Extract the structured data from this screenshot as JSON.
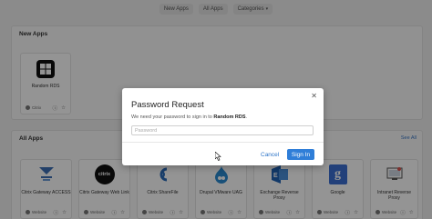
{
  "nav": {
    "new_apps": "New Apps",
    "all_apps": "All Apps",
    "categories": "Categories"
  },
  "new_apps": {
    "title": "New Apps",
    "cards": [
      {
        "name": "Random RDS",
        "type": "Citrix",
        "icon": "windows-tile-icon"
      }
    ]
  },
  "all_apps": {
    "title": "All Apps",
    "see_all": "See All",
    "cards": [
      {
        "name": "Citrix Gateway ACCESS",
        "type": "Website",
        "icon": "citrix-gateway-icon"
      },
      {
        "name": "Citrix Gateway Web Link",
        "type": "Website",
        "icon": "citrix-logo-icon"
      },
      {
        "name": "Citrix ShareFile",
        "type": "Website",
        "icon": "sharefile-icon"
      },
      {
        "name": "Drupal VMware UAG",
        "type": "Website",
        "icon": "drupal-icon"
      },
      {
        "name": "Exchange Reverse Proxy",
        "type": "Website",
        "icon": "exchange-icon"
      },
      {
        "name": "Google",
        "type": "Website",
        "icon": "google-icon"
      },
      {
        "name": "Intranet Reverse Proxy",
        "type": "Website",
        "icon": "intranet-icon"
      }
    ]
  },
  "modal": {
    "title": "Password Request",
    "message_prefix": "We need your password to sign in to",
    "message_app": "Random RDS",
    "message_suffix": ".",
    "password_placeholder": "Password",
    "cancel_label": "Cancel",
    "signin_label": "Sign In"
  },
  "colors": {
    "accent": "#2f7ed8",
    "link": "#2f76c9"
  }
}
